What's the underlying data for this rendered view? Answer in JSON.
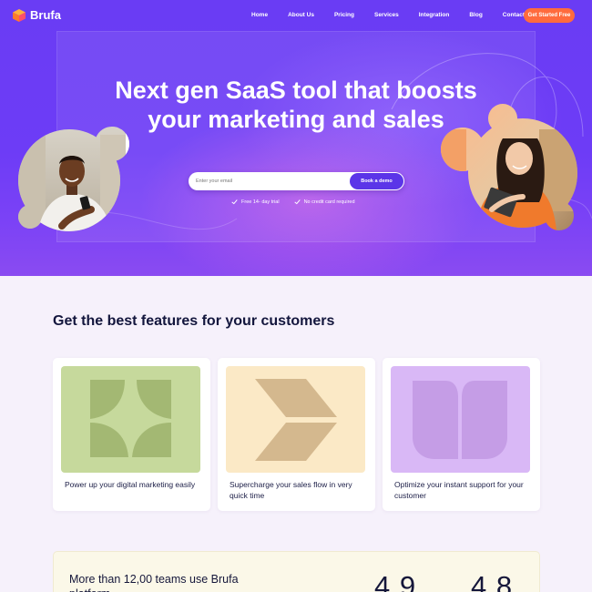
{
  "brand": {
    "name": "Brufa",
    "accent": "#6a3cf4",
    "cta_color": "#ff6b3d"
  },
  "nav": {
    "links": [
      "Home",
      "About Us",
      "Pricing",
      "Services",
      "Integration",
      "Blog",
      "Contact"
    ],
    "cta_label": "Get Started Free"
  },
  "hero": {
    "title": "Next gen SaaS tool that boosts your marketing and sales",
    "email_placeholder": "Enter your email",
    "button_label": "Book a demo",
    "checks": [
      "Free 14- day trial",
      "No credit card required"
    ]
  },
  "features": {
    "title": "Get the best features for your customers",
    "cards": [
      {
        "text": "Power up your digital marketing easily",
        "icon": "leaf-shapes-icon",
        "bg": "#c6d99c"
      },
      {
        "text": "Supercharge your sales flow in very quick time",
        "icon": "parallelogram-shapes-icon",
        "bg": "#fbe9c6"
      },
      {
        "text": "Optimize your instant support for your customer",
        "icon": "book-shapes-icon",
        "bg": "#d9b8f6"
      }
    ]
  },
  "stats": {
    "text": "More than 12,00 teams use Brufa platform",
    "numbers": [
      "4.9",
      "4.8"
    ]
  }
}
